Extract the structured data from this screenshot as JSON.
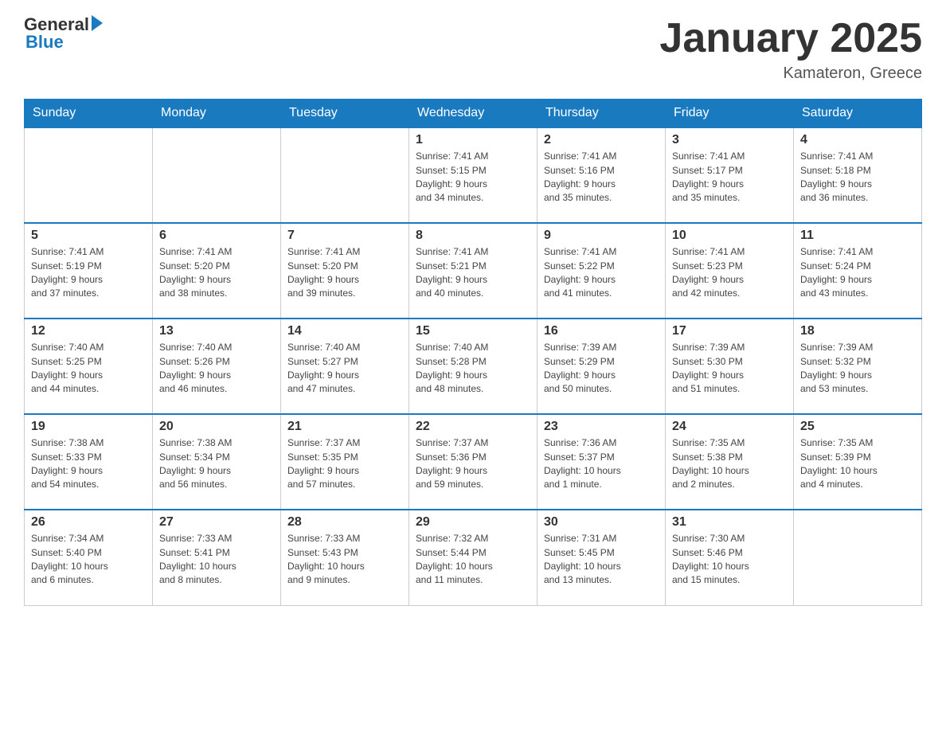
{
  "logo": {
    "general": "General",
    "blue": "Blue",
    "arrow": "▶"
  },
  "header": {
    "title": "January 2025",
    "location": "Kamateron, Greece"
  },
  "days_of_week": [
    "Sunday",
    "Monday",
    "Tuesday",
    "Wednesday",
    "Thursday",
    "Friday",
    "Saturday"
  ],
  "weeks": [
    [
      {
        "num": "",
        "info": ""
      },
      {
        "num": "",
        "info": ""
      },
      {
        "num": "",
        "info": ""
      },
      {
        "num": "1",
        "info": "Sunrise: 7:41 AM\nSunset: 5:15 PM\nDaylight: 9 hours\nand 34 minutes."
      },
      {
        "num": "2",
        "info": "Sunrise: 7:41 AM\nSunset: 5:16 PM\nDaylight: 9 hours\nand 35 minutes."
      },
      {
        "num": "3",
        "info": "Sunrise: 7:41 AM\nSunset: 5:17 PM\nDaylight: 9 hours\nand 35 minutes."
      },
      {
        "num": "4",
        "info": "Sunrise: 7:41 AM\nSunset: 5:18 PM\nDaylight: 9 hours\nand 36 minutes."
      }
    ],
    [
      {
        "num": "5",
        "info": "Sunrise: 7:41 AM\nSunset: 5:19 PM\nDaylight: 9 hours\nand 37 minutes."
      },
      {
        "num": "6",
        "info": "Sunrise: 7:41 AM\nSunset: 5:20 PM\nDaylight: 9 hours\nand 38 minutes."
      },
      {
        "num": "7",
        "info": "Sunrise: 7:41 AM\nSunset: 5:20 PM\nDaylight: 9 hours\nand 39 minutes."
      },
      {
        "num": "8",
        "info": "Sunrise: 7:41 AM\nSunset: 5:21 PM\nDaylight: 9 hours\nand 40 minutes."
      },
      {
        "num": "9",
        "info": "Sunrise: 7:41 AM\nSunset: 5:22 PM\nDaylight: 9 hours\nand 41 minutes."
      },
      {
        "num": "10",
        "info": "Sunrise: 7:41 AM\nSunset: 5:23 PM\nDaylight: 9 hours\nand 42 minutes."
      },
      {
        "num": "11",
        "info": "Sunrise: 7:41 AM\nSunset: 5:24 PM\nDaylight: 9 hours\nand 43 minutes."
      }
    ],
    [
      {
        "num": "12",
        "info": "Sunrise: 7:40 AM\nSunset: 5:25 PM\nDaylight: 9 hours\nand 44 minutes."
      },
      {
        "num": "13",
        "info": "Sunrise: 7:40 AM\nSunset: 5:26 PM\nDaylight: 9 hours\nand 46 minutes."
      },
      {
        "num": "14",
        "info": "Sunrise: 7:40 AM\nSunset: 5:27 PM\nDaylight: 9 hours\nand 47 minutes."
      },
      {
        "num": "15",
        "info": "Sunrise: 7:40 AM\nSunset: 5:28 PM\nDaylight: 9 hours\nand 48 minutes."
      },
      {
        "num": "16",
        "info": "Sunrise: 7:39 AM\nSunset: 5:29 PM\nDaylight: 9 hours\nand 50 minutes."
      },
      {
        "num": "17",
        "info": "Sunrise: 7:39 AM\nSunset: 5:30 PM\nDaylight: 9 hours\nand 51 minutes."
      },
      {
        "num": "18",
        "info": "Sunrise: 7:39 AM\nSunset: 5:32 PM\nDaylight: 9 hours\nand 53 minutes."
      }
    ],
    [
      {
        "num": "19",
        "info": "Sunrise: 7:38 AM\nSunset: 5:33 PM\nDaylight: 9 hours\nand 54 minutes."
      },
      {
        "num": "20",
        "info": "Sunrise: 7:38 AM\nSunset: 5:34 PM\nDaylight: 9 hours\nand 56 minutes."
      },
      {
        "num": "21",
        "info": "Sunrise: 7:37 AM\nSunset: 5:35 PM\nDaylight: 9 hours\nand 57 minutes."
      },
      {
        "num": "22",
        "info": "Sunrise: 7:37 AM\nSunset: 5:36 PM\nDaylight: 9 hours\nand 59 minutes."
      },
      {
        "num": "23",
        "info": "Sunrise: 7:36 AM\nSunset: 5:37 PM\nDaylight: 10 hours\nand 1 minute."
      },
      {
        "num": "24",
        "info": "Sunrise: 7:35 AM\nSunset: 5:38 PM\nDaylight: 10 hours\nand 2 minutes."
      },
      {
        "num": "25",
        "info": "Sunrise: 7:35 AM\nSunset: 5:39 PM\nDaylight: 10 hours\nand 4 minutes."
      }
    ],
    [
      {
        "num": "26",
        "info": "Sunrise: 7:34 AM\nSunset: 5:40 PM\nDaylight: 10 hours\nand 6 minutes."
      },
      {
        "num": "27",
        "info": "Sunrise: 7:33 AM\nSunset: 5:41 PM\nDaylight: 10 hours\nand 8 minutes."
      },
      {
        "num": "28",
        "info": "Sunrise: 7:33 AM\nSunset: 5:43 PM\nDaylight: 10 hours\nand 9 minutes."
      },
      {
        "num": "29",
        "info": "Sunrise: 7:32 AM\nSunset: 5:44 PM\nDaylight: 10 hours\nand 11 minutes."
      },
      {
        "num": "30",
        "info": "Sunrise: 7:31 AM\nSunset: 5:45 PM\nDaylight: 10 hours\nand 13 minutes."
      },
      {
        "num": "31",
        "info": "Sunrise: 7:30 AM\nSunset: 5:46 PM\nDaylight: 10 hours\nand 15 minutes."
      },
      {
        "num": "",
        "info": ""
      }
    ]
  ]
}
